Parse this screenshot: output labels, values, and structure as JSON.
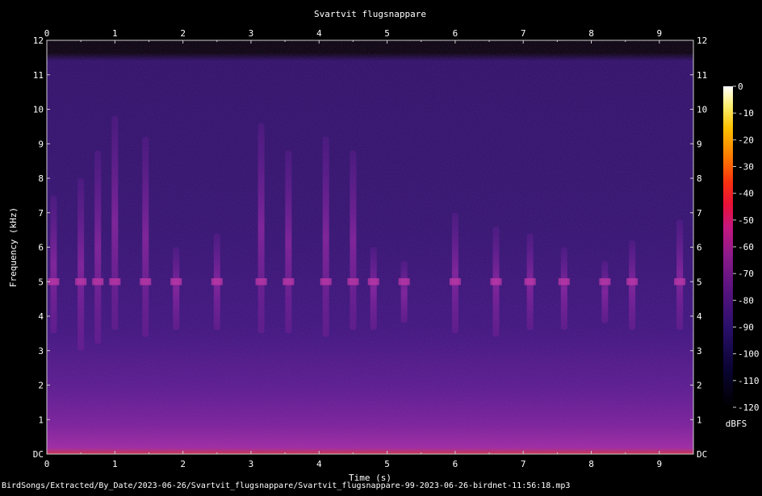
{
  "chart_data": {
    "type": "heatmap",
    "title": "Svartvit flugsnappare",
    "xlabel": "Time (s)",
    "ylabel": "Frequency (kHz)",
    "xlim": [
      0,
      9.5
    ],
    "ylim": [
      0,
      12
    ],
    "x_ticks": [
      "0",
      "1",
      "2",
      "3",
      "4",
      "5",
      "6",
      "7",
      "8",
      "9"
    ],
    "y_ticks": [
      "DC",
      "1",
      "2",
      "3",
      "4",
      "5",
      "6",
      "7",
      "8",
      "9",
      "10",
      "11",
      "12"
    ],
    "colorbar": {
      "label": "dBFS",
      "range": [
        -120,
        0
      ],
      "ticks": [
        "0",
        "-10",
        "-20",
        "-30",
        "-40",
        "-50",
        "-60",
        "-70",
        "-80",
        "-90",
        "-100",
        "-110",
        "-120"
      ]
    },
    "calls": [
      {
        "t": 0.1,
        "f_low": 3.5,
        "f_high": 7.5
      },
      {
        "t": 0.5,
        "f_low": 3.0,
        "f_high": 8.0
      },
      {
        "t": 0.75,
        "f_low": 3.2,
        "f_high": 8.8
      },
      {
        "t": 1.0,
        "f_low": 3.6,
        "f_high": 9.8
      },
      {
        "t": 1.45,
        "f_low": 3.4,
        "f_high": 9.2
      },
      {
        "t": 1.9,
        "f_low": 3.6,
        "f_high": 6.0
      },
      {
        "t": 2.5,
        "f_low": 3.6,
        "f_high": 6.4
      },
      {
        "t": 3.15,
        "f_low": 3.5,
        "f_high": 9.6
      },
      {
        "t": 3.55,
        "f_low": 3.5,
        "f_high": 8.8
      },
      {
        "t": 4.1,
        "f_low": 3.4,
        "f_high": 9.2
      },
      {
        "t": 4.5,
        "f_low": 3.6,
        "f_high": 8.8
      },
      {
        "t": 4.8,
        "f_low": 3.6,
        "f_high": 6.0
      },
      {
        "t": 5.25,
        "f_low": 3.8,
        "f_high": 5.6
      },
      {
        "t": 6.0,
        "f_low": 3.5,
        "f_high": 7.0
      },
      {
        "t": 6.6,
        "f_low": 3.4,
        "f_high": 6.6
      },
      {
        "t": 7.1,
        "f_low": 3.6,
        "f_high": 6.4
      },
      {
        "t": 7.6,
        "f_low": 3.6,
        "f_high": 6.0
      },
      {
        "t": 8.2,
        "f_low": 3.8,
        "f_high": 5.6
      },
      {
        "t": 8.6,
        "f_low": 3.6,
        "f_high": 6.2
      },
      {
        "t": 9.3,
        "f_low": 3.6,
        "f_high": 6.8
      }
    ]
  },
  "footer": "BirdSongs/Extracted/By_Date/2023-06-26/Svartvit_flugsnappare/Svartvit_flugsnappare-99-2023-06-26-birdnet-11:56:18.mp3"
}
